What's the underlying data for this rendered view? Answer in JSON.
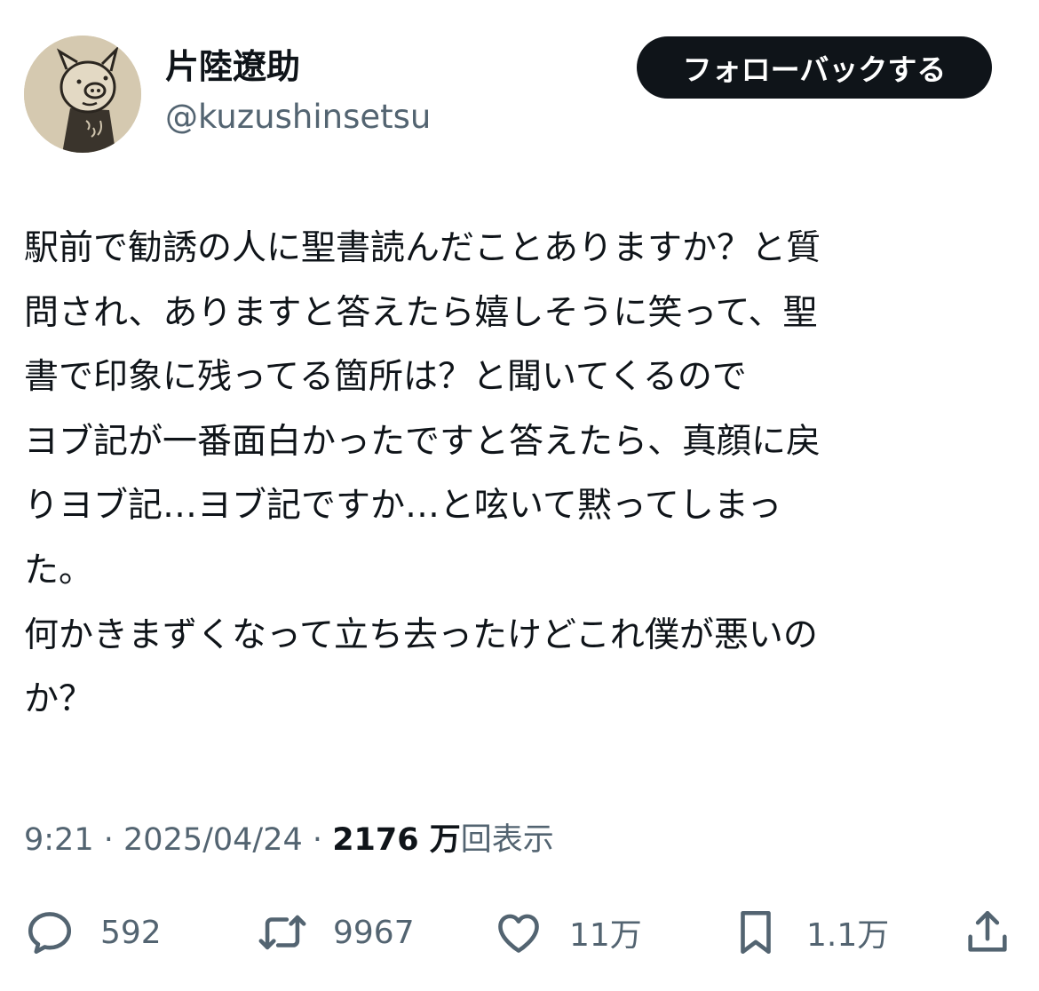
{
  "user": {
    "display_name": "片陸遼助",
    "handle": "@kuzushinsetsu",
    "avatar": "pig-doodle-avatar"
  },
  "follow_button_label": "フォローバックする",
  "tweet": {
    "lines": [
      "駅前で勧誘の人に聖書読んだことありますか？と質",
      "問され、ありますと答えたら嬉しそうに笑って、聖",
      "書で印象に残ってる箇所は？と聞いてくるので",
      "ヨブ記が一番面白かったですと答えたら、真顔に戻",
      "りヨブ記…ヨブ記ですか…と呟いて黙ってしまっ",
      "た。",
      "何かきまずくなって立ち去ったけどこれ僕が悪いの",
      "か？"
    ]
  },
  "meta": {
    "time": "9:21",
    "separator": "·",
    "date": "2025/04/24",
    "views_count": "2176 万",
    "views_label": "回表示"
  },
  "actions": {
    "replies": {
      "icon": "reply-icon",
      "count": "592"
    },
    "retweets": {
      "icon": "retweet-icon",
      "count": "9967"
    },
    "likes": {
      "icon": "heart-icon",
      "count": "11万"
    },
    "bookmarks": {
      "icon": "bookmark-icon",
      "count": "1.1万"
    },
    "share": {
      "icon": "share-icon"
    }
  },
  "colors": {
    "text": "#0f1419",
    "secondary": "#536471",
    "button_bg": "#0f1419",
    "button_text": "#ffffff"
  }
}
